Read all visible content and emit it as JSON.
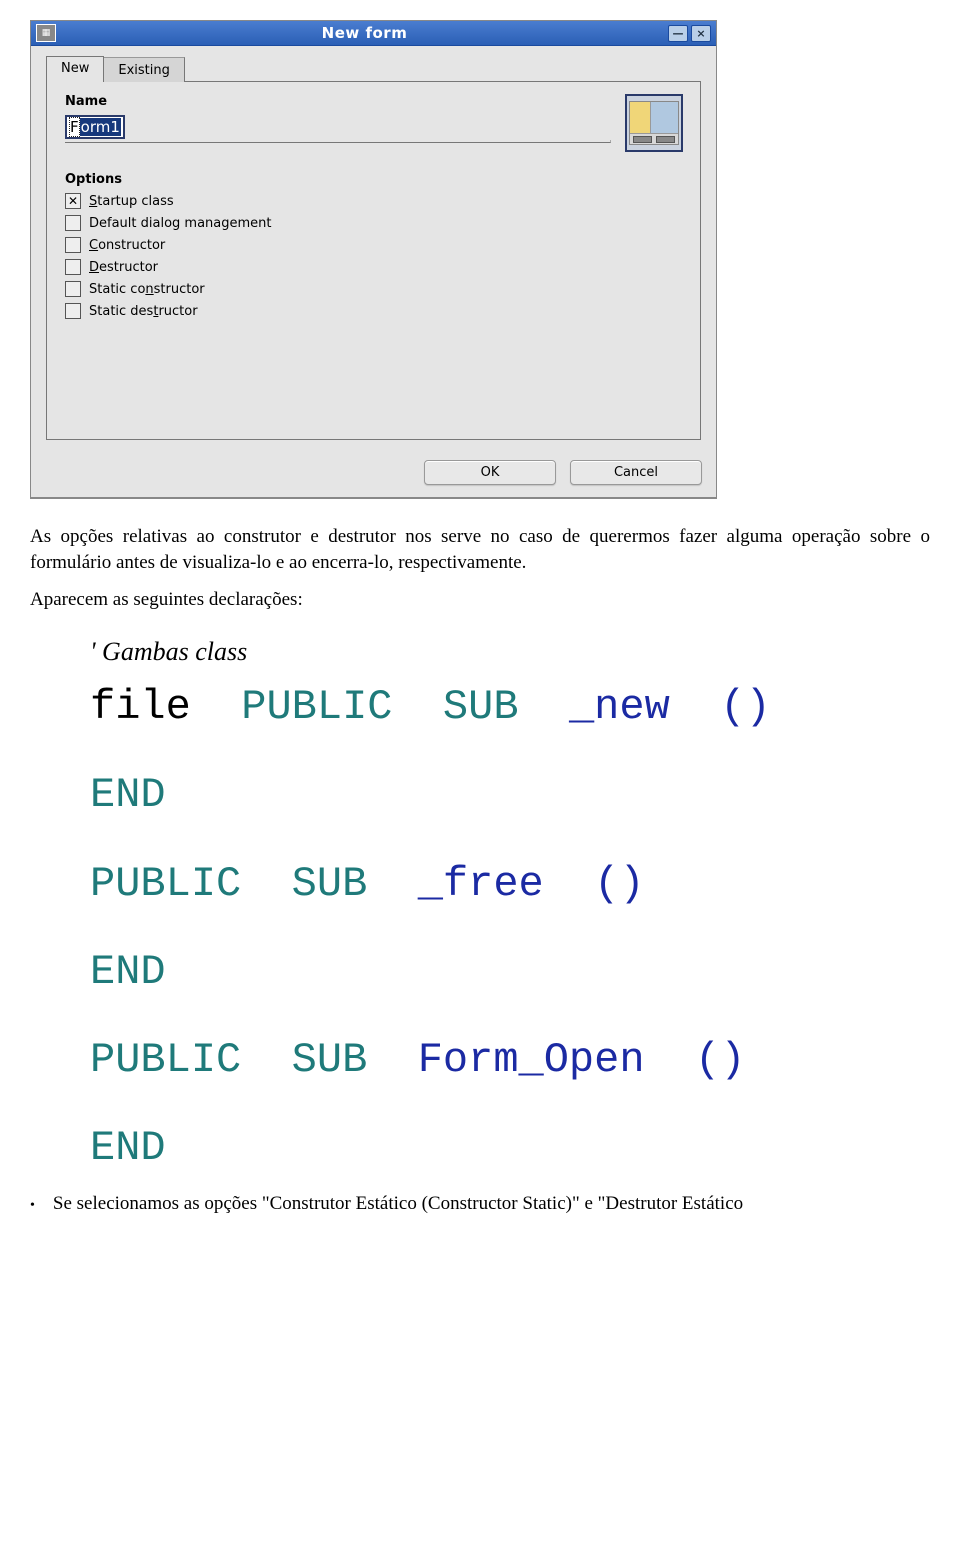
{
  "dialog": {
    "title": "New form",
    "tabs": {
      "new": "New",
      "existing": "Existing"
    },
    "name_label": "Name",
    "name_value_first": "F",
    "name_value_rest": "orm1",
    "options_label": "Options",
    "options": {
      "startup": "Startup class",
      "default_dialog": "Default dialog management",
      "constructor": "Constructor",
      "destructor": "Destructor",
      "static_constructor": "Static constructor",
      "static_destructor": "Static destructor"
    },
    "ok": "OK",
    "cancel": "Cancel"
  },
  "paragraphs": {
    "p1": "As opções relativas ao construtor e destrutor nos serve no caso de querermos fazer alguma operação sobre o formulário antes de visualiza-lo e ao encerra-lo, respectivamente.",
    "p2": "Aparecem as seguintes declarações:",
    "code_heading": "' Gambas class",
    "bullet": "Se selecionamos as opções \"Construtor Estático (Constructor Static)\" e \"Destrutor Estático"
  },
  "code": {
    "file": "file",
    "public": "PUBLIC",
    "sub": "SUB",
    "end": "END",
    "fn_new": "_new",
    "fn_free": "_free",
    "fn_open": "Form_Open",
    "paren": "()"
  }
}
